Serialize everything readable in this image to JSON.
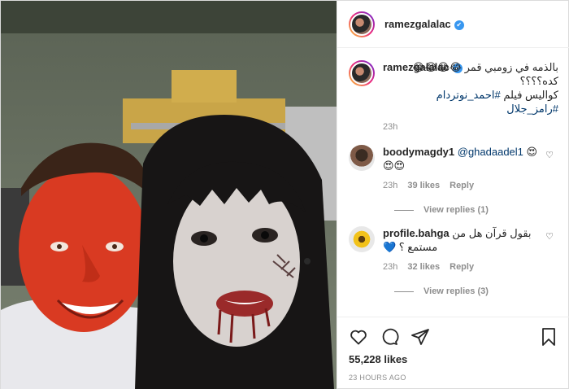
{
  "post": {
    "username": "ramezgalalac",
    "verified": true
  },
  "caption": {
    "username": "ramezgalalac",
    "line1": "بالذمه في زومبي قمر 😂😂😂😂كده؟؟؟؟",
    "line2_prefix": "كواليس فيلم ",
    "hashtag1": "#احمد_نوتردام",
    "hashtag2": "#رامز_جلال",
    "age": "23h"
  },
  "comments": [
    {
      "username": "boodymagdy1",
      "mention": "@ghadaadel1",
      "emoji_a": "😍",
      "emoji_b": "😍😍",
      "age": "23h",
      "likes": "39 likes",
      "reply": "Reply",
      "view_replies": "View replies (1)"
    },
    {
      "username": "profile.bahga",
      "text1": "بقول قرآن هل من",
      "text2": "مستمع ؟ 💙",
      "age": "23h",
      "likes": "32 likes",
      "reply": "Reply",
      "view_replies": "View replies (3)"
    }
  ],
  "footer": {
    "likes": "55,228 likes",
    "timestamp": "23 HOURS AGO"
  }
}
